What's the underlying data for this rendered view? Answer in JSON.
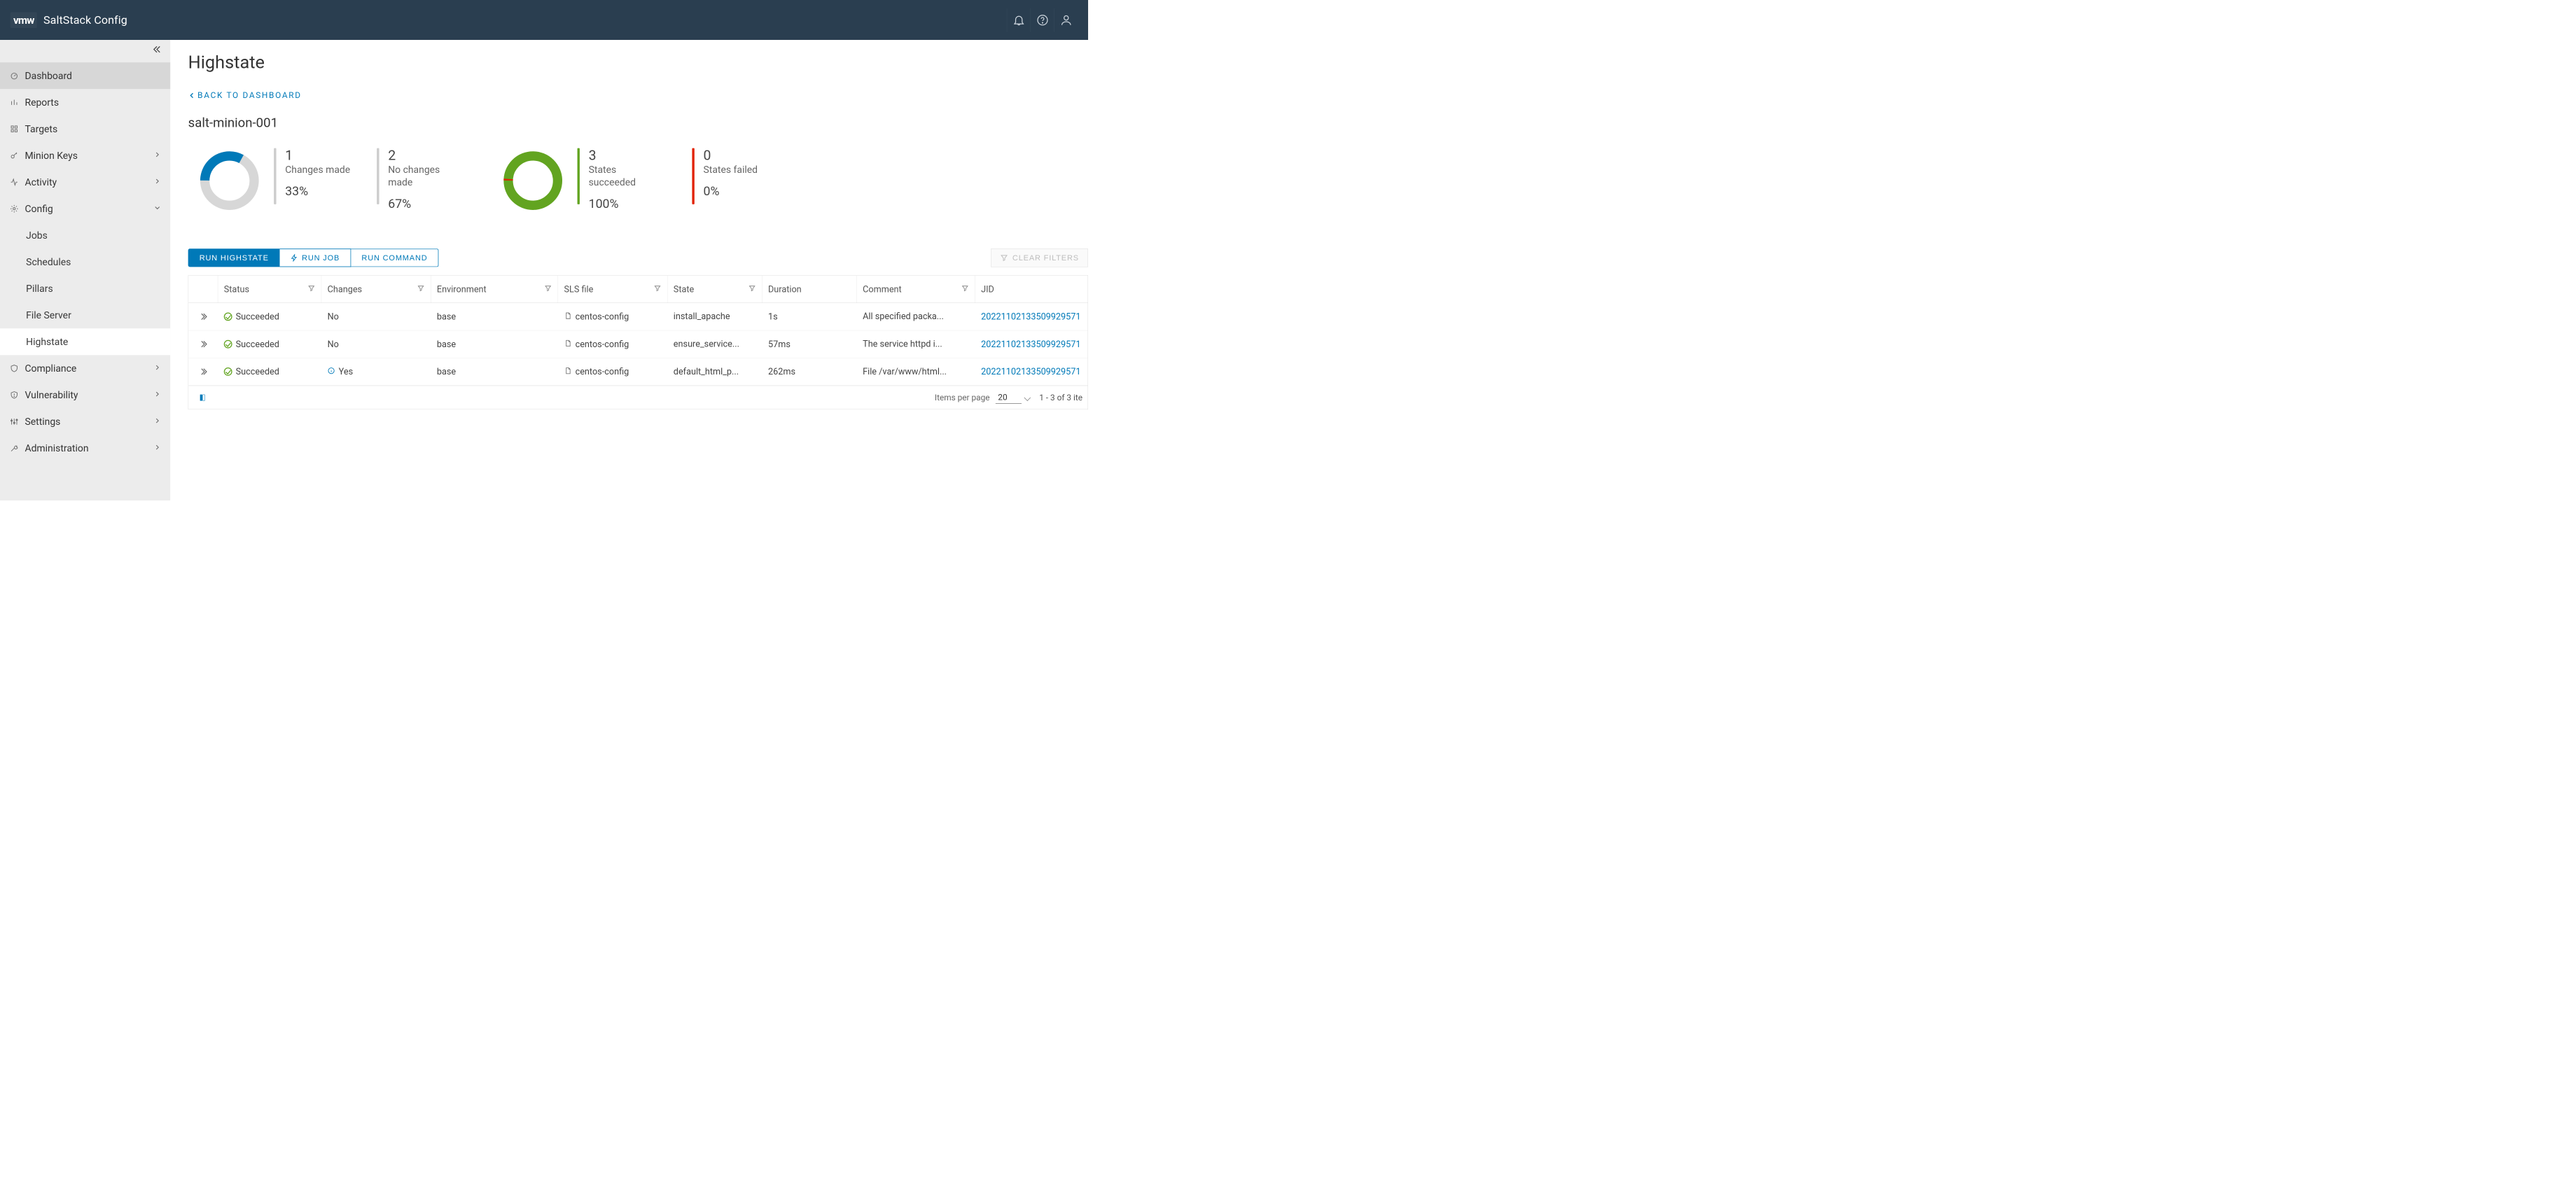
{
  "header": {
    "logo": "vmw",
    "product": "SaltStack Config"
  },
  "sidebar": {
    "items": [
      {
        "label": "Dashboard",
        "icon": "gauge",
        "active": true
      },
      {
        "label": "Reports",
        "icon": "bar-chart"
      },
      {
        "label": "Targets",
        "icon": "grid"
      },
      {
        "label": "Minion Keys",
        "icon": "key",
        "chev": "right"
      },
      {
        "label": "Activity",
        "icon": "activity",
        "chev": "right"
      },
      {
        "label": "Config",
        "icon": "gear",
        "chev": "down",
        "children": [
          {
            "label": "Jobs"
          },
          {
            "label": "Schedules"
          },
          {
            "label": "Pillars"
          },
          {
            "label": "File Server"
          },
          {
            "label": "Highstate",
            "selected": true
          }
        ]
      },
      {
        "label": "Compliance",
        "icon": "shield",
        "chev": "right"
      },
      {
        "label": "Vulnerability",
        "icon": "shield",
        "chev": "right"
      },
      {
        "label": "Settings",
        "icon": "sliders",
        "chev": "right"
      },
      {
        "label": "Administration",
        "icon": "wrench",
        "chev": "right"
      }
    ]
  },
  "page": {
    "title": "Highstate",
    "back_label": "BACK TO DASHBOARD",
    "minion": "salt-minion-001"
  },
  "stats": {
    "changes": {
      "count": "1",
      "label": "Changes made",
      "pct": "33%"
    },
    "no_changes": {
      "count": "2",
      "label": "No changes made",
      "pct": "67%"
    },
    "succeeded": {
      "count": "3",
      "label": "States succeeded",
      "pct": "100%"
    },
    "failed": {
      "count": "0",
      "label": "States failed",
      "pct": "0%"
    }
  },
  "buttons": {
    "run_highstate": "RUN HIGHSTATE",
    "run_job": "RUN JOB",
    "run_command": "RUN COMMAND",
    "clear_filters": "CLEAR FILTERS"
  },
  "table": {
    "columns": [
      "Status",
      "Changes",
      "Environment",
      "SLS file",
      "State",
      "Duration",
      "Comment",
      "JID"
    ],
    "rows": [
      {
        "status": "Succeeded",
        "changes": "No",
        "changes_info": false,
        "env": "base",
        "sls": "centos-config",
        "state": "install_apache",
        "duration": "1s",
        "comment": "All specified packa...",
        "jid": "20221102133509929571"
      },
      {
        "status": "Succeeded",
        "changes": "No",
        "changes_info": false,
        "env": "base",
        "sls": "centos-config",
        "state": "ensure_service...",
        "duration": "57ms",
        "comment": "The service httpd i...",
        "jid": "20221102133509929571"
      },
      {
        "status": "Succeeded",
        "changes": "Yes",
        "changes_info": true,
        "env": "base",
        "sls": "centos-config",
        "state": "default_html_p...",
        "duration": "262ms",
        "comment": "File /var/www/html...",
        "jid": "20221102133509929571"
      }
    ],
    "footer": {
      "items_label": "Items per page",
      "page_size": "20",
      "range": "1 - 3 of 3 ite"
    }
  },
  "colors": {
    "primary": "#0079B8",
    "green": "#62A420",
    "red": "#E12200",
    "grey": "#CCCCCC"
  }
}
